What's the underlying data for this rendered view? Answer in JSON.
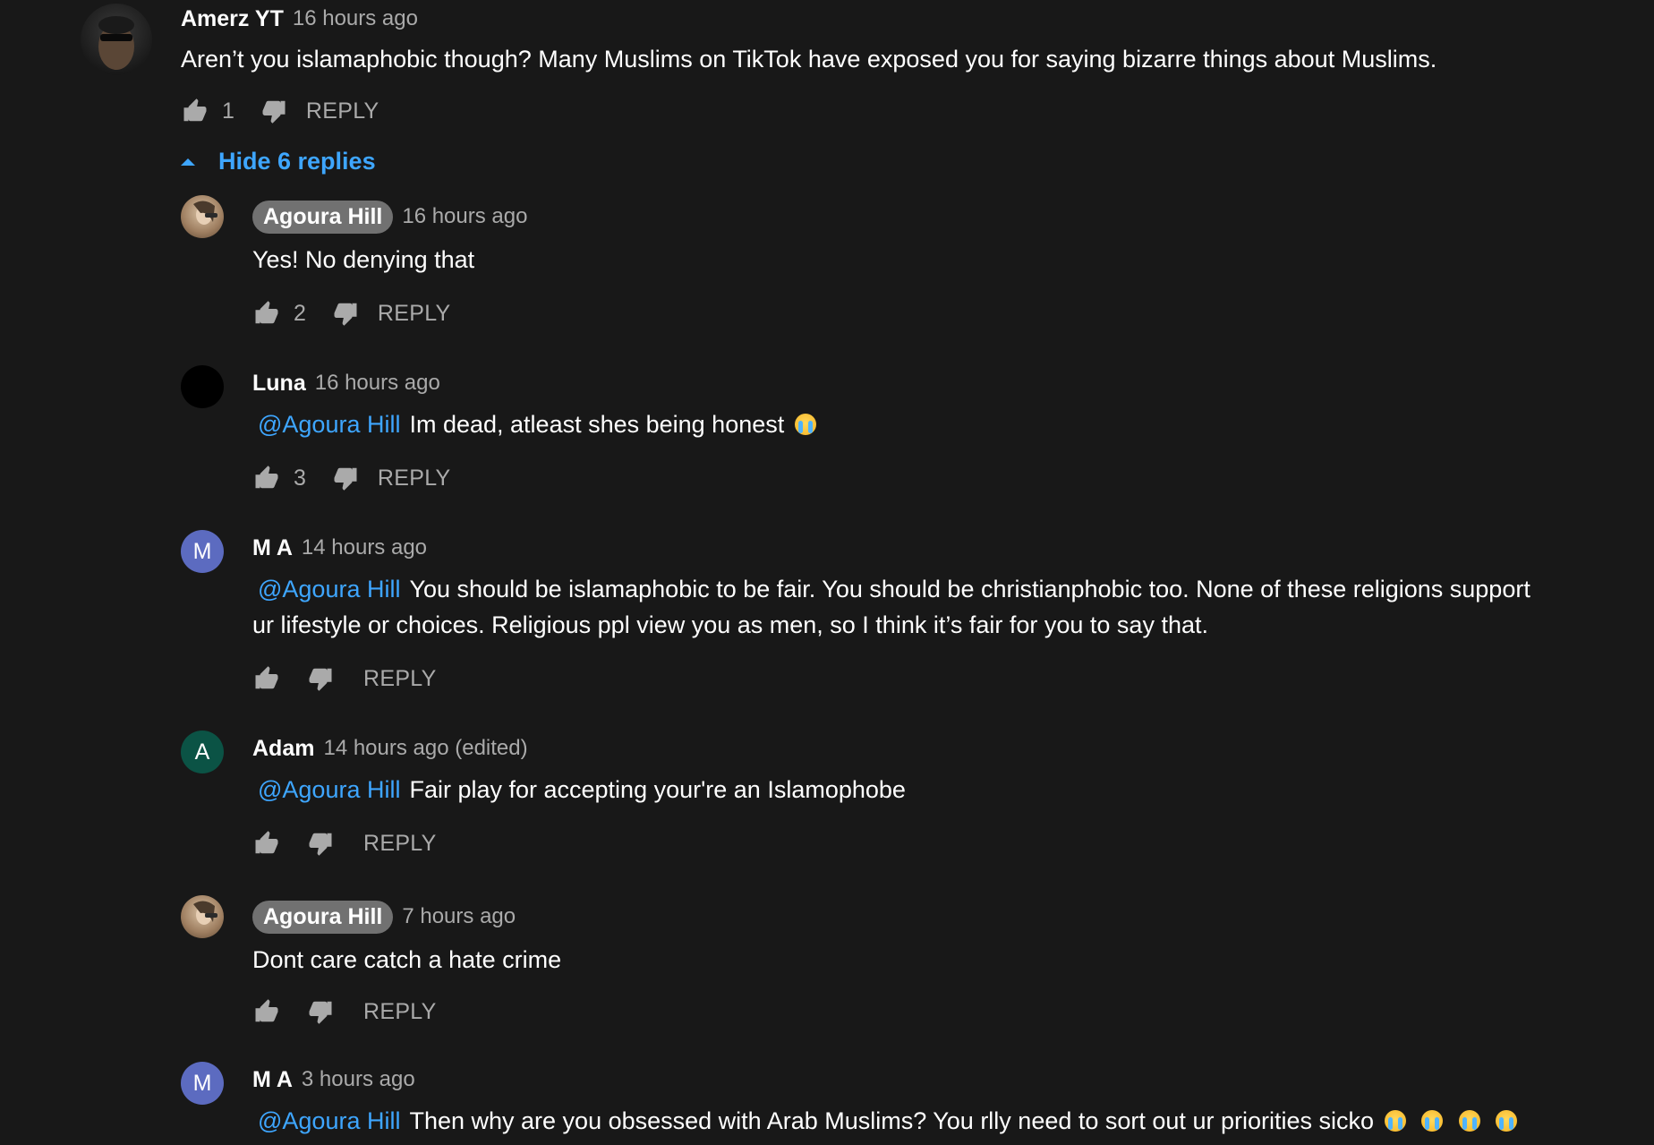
{
  "top_comment": {
    "author": "Amerz YT",
    "time": "16 hours ago",
    "text": "Aren’t you islamaphobic though? Many Muslims on TikTok have exposed you for saying bizarre things about Muslims.",
    "likes": "1",
    "reply_label": "REPLY",
    "hide_replies_label": "Hide 6 replies"
  },
  "replies": [
    {
      "author": "Agoura Hill",
      "is_creator": true,
      "time": "16 hours ago",
      "mention": "",
      "text": "Yes! No denying that",
      "likes": "2",
      "reply_label": "REPLY"
    },
    {
      "author": "Luna",
      "is_creator": false,
      "time": "16 hours ago",
      "mention": "@Agoura Hill",
      "text": "Im dead, atleast shes being honest",
      "emoji_count": 1,
      "likes": "3",
      "reply_label": "REPLY"
    },
    {
      "author": "M A",
      "avatar_letter": "M",
      "avatar_color": "#5c6bc0",
      "is_creator": false,
      "time": "14 hours ago",
      "mention": "@Agoura Hill",
      "text_line1": "You should be islamaphobic to be fair. You should be christianphobic too. None of these religions support",
      "text_line2": "ur lifestyle or choices. Religious ppl view you as men, so I think it’s fair for you to say that.",
      "likes": "",
      "reply_label": "REPLY"
    },
    {
      "author": "Adam",
      "avatar_letter": "A",
      "avatar_color": "#0b5345",
      "is_creator": false,
      "time": "14 hours ago (edited)",
      "mention": "@Agoura Hill",
      "text": "Fair play for accepting your're an Islamophobe",
      "likes": "",
      "reply_label": "REPLY"
    },
    {
      "author": "Agoura Hill",
      "is_creator": true,
      "time": "7 hours ago",
      "mention": "",
      "text": "Dont care catch a hate crime",
      "likes": "",
      "reply_label": "REPLY"
    },
    {
      "author": "M A",
      "avatar_letter": "M",
      "avatar_color": "#5c6bc0",
      "is_creator": false,
      "time": "3 hours ago",
      "mention": "@Agoura Hill",
      "text": "Then why are you obsessed with Arab Muslims? You rlly need to sort out ur priorities sicko",
      "emoji_count": 4
    }
  ],
  "colors": {
    "background": "#181818",
    "link": "#3ea6ff",
    "secondary_text": "#aaaaaa",
    "creator_chip": "#717171"
  }
}
